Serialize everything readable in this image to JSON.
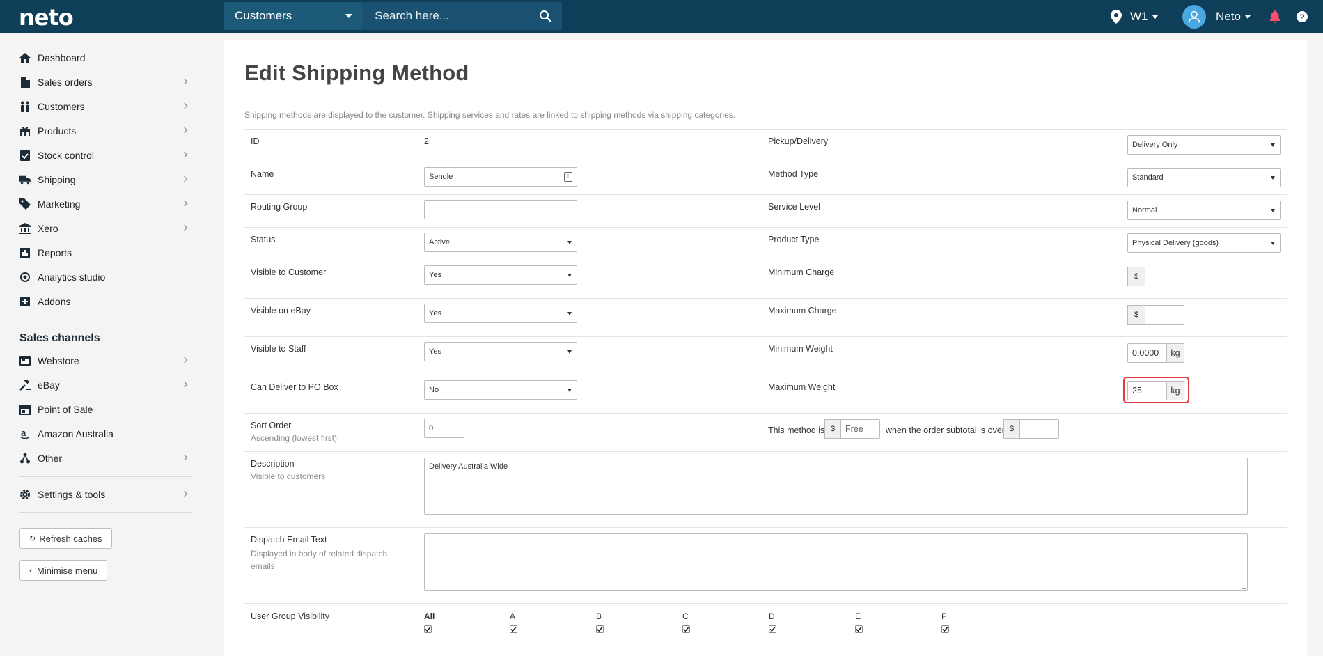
{
  "topbar": {
    "logo": "neto",
    "search_category": "Customers",
    "search_placeholder": "Search here...",
    "location": "W1",
    "user": "Neto"
  },
  "sidebar": {
    "items": [
      {
        "label": "Dashboard",
        "icon": "home-icon"
      },
      {
        "label": "Sales orders",
        "icon": "document-icon"
      },
      {
        "label": "Customers",
        "icon": "people-icon"
      },
      {
        "label": "Products",
        "icon": "gift-icon"
      },
      {
        "label": "Stock control",
        "icon": "clipboard-check-icon"
      },
      {
        "label": "Shipping",
        "icon": "truck-icon"
      },
      {
        "label": "Marketing",
        "icon": "tag-icon"
      },
      {
        "label": "Xero",
        "icon": "bank-icon"
      },
      {
        "label": "Reports",
        "icon": "bar-chart-icon"
      },
      {
        "label": "Analytics studio",
        "icon": "analytics-icon"
      },
      {
        "label": "Addons",
        "icon": "plus-square-icon"
      }
    ],
    "sales_channels_title": "Sales channels",
    "channels": [
      {
        "label": "Webstore",
        "icon": "browser-icon"
      },
      {
        "label": "eBay",
        "icon": "gavel-icon"
      },
      {
        "label": "Point of Sale",
        "icon": "store-icon"
      },
      {
        "label": "Amazon Australia",
        "icon": "amazon-icon"
      },
      {
        "label": "Other",
        "icon": "share-icon"
      }
    ],
    "settings": "Settings & tools",
    "refresh": "Refresh caches",
    "minimise": "Minimise menu"
  },
  "page": {
    "title": "Edit Shipping Method",
    "intro": "Shipping methods are displayed to the customer. Shipping services and rates are linked to shipping methods via shipping categories."
  },
  "form": {
    "id_label": "ID",
    "id_value": "2",
    "name_label": "Name",
    "name_value": "Sendle",
    "routing_label": "Routing Group",
    "routing_value": "",
    "status_label": "Status",
    "status_value": "Active",
    "visible_customer_label": "Visible to Customer",
    "visible_customer_value": "Yes",
    "visible_ebay_label": "Visible on eBay",
    "visible_ebay_value": "Yes",
    "visible_staff_label": "Visible to Staff",
    "visible_staff_value": "Yes",
    "po_box_label": "Can Deliver to PO Box",
    "po_box_value": "No",
    "sort_label": "Sort Order",
    "sort_sub": "Ascending (lowest first)",
    "sort_value": "0",
    "description_label": "Description",
    "description_sub": "Visible to customers",
    "description_value": "Delivery Australia Wide",
    "dispatch_label": "Dispatch Email Text",
    "dispatch_sub": "Displayed in body of related dispatch emails",
    "dispatch_value": "",
    "pickup_label": "Pickup/Delivery",
    "pickup_value": "Delivery Only",
    "method_type_label": "Method Type",
    "method_type_value": "Standard",
    "service_level_label": "Service Level",
    "service_level_value": "Normal",
    "product_type_label": "Product Type",
    "product_type_value": "Physical Delivery (goods)",
    "min_charge_label": "Minimum Charge",
    "max_charge_label": "Maximum Charge",
    "currency": "$",
    "min_weight_label": "Minimum Weight",
    "min_weight_value": "0.0000",
    "max_weight_label": "Maximum Weight",
    "max_weight_value": "25",
    "weight_unit": "kg",
    "free_text_1": "This method is",
    "free_placeholder": "Free",
    "free_text_2": "when the order subtotal is over",
    "user_group_label": "User Group Visibility",
    "user_groups": [
      "All",
      "A",
      "B",
      "C",
      "D",
      "E",
      "F"
    ]
  },
  "colors": {
    "topbar": "#0f3f58",
    "highlight": "#e0393e",
    "bell": "#ff4d6d"
  }
}
